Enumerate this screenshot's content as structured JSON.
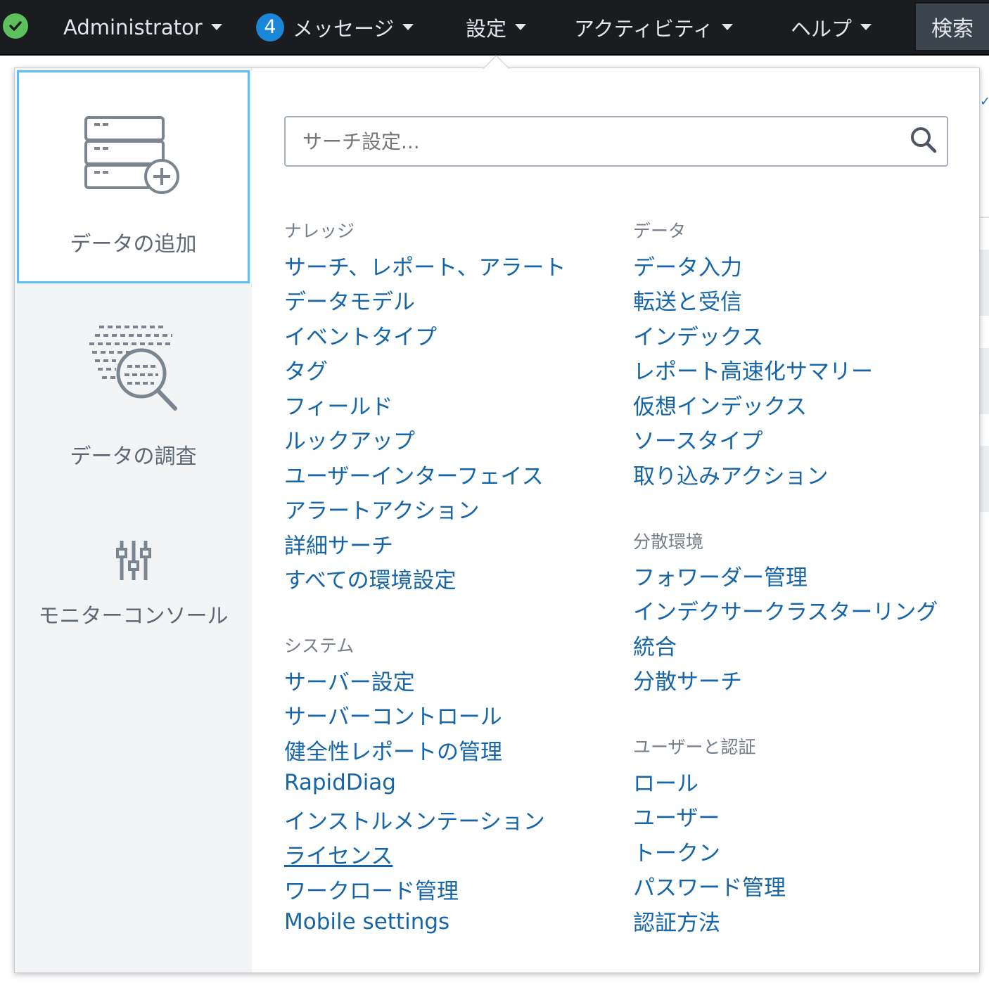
{
  "topbar": {
    "user": "Administrator",
    "message_count": "4",
    "messages": "メッセージ",
    "settings": "設定",
    "activity": "アクティビティ",
    "help": "ヘルプ",
    "search": "検索"
  },
  "panel": {
    "tiles": [
      {
        "label": "データの追加",
        "icon": "add-data-icon"
      },
      {
        "label": "データの調査",
        "icon": "explore-data-icon"
      },
      {
        "label": "モニターコンソール",
        "icon": "monitoring-console-icon"
      }
    ],
    "search_placeholder": "サーチ設定...",
    "sections": {
      "knowledge": {
        "title": "ナレッジ",
        "links": [
          "サーチ、レポート、アラート",
          "データモデル",
          "イベントタイプ",
          "タグ",
          "フィールド",
          "ルックアップ",
          "ユーザーインターフェイス",
          "アラートアクション",
          "詳細サーチ",
          "すべての環境設定"
        ]
      },
      "system": {
        "title": "システム",
        "links": [
          "サーバー設定",
          "サーバーコントロール",
          "健全性レポートの管理",
          "RapidDiag",
          "インストルメンテーション",
          "ライセンス",
          "ワークロード管理",
          "Mobile settings"
        ]
      },
      "data": {
        "title": "データ",
        "links": [
          "データ入力",
          "転送と受信",
          "インデックス",
          "レポート高速化サマリー",
          "仮想インデックス",
          "ソースタイプ",
          "取り込みアクション"
        ]
      },
      "distributed": {
        "title": "分散環境",
        "links": [
          "フォワーダー管理",
          "インデクサークラスターリング",
          "統合",
          "分散サーチ"
        ]
      },
      "users_auth": {
        "title": "ユーザーと認証",
        "links": [
          "ロール",
          "ユーザー",
          "トークン",
          "パスワード管理",
          "認証方法"
        ]
      }
    }
  }
}
